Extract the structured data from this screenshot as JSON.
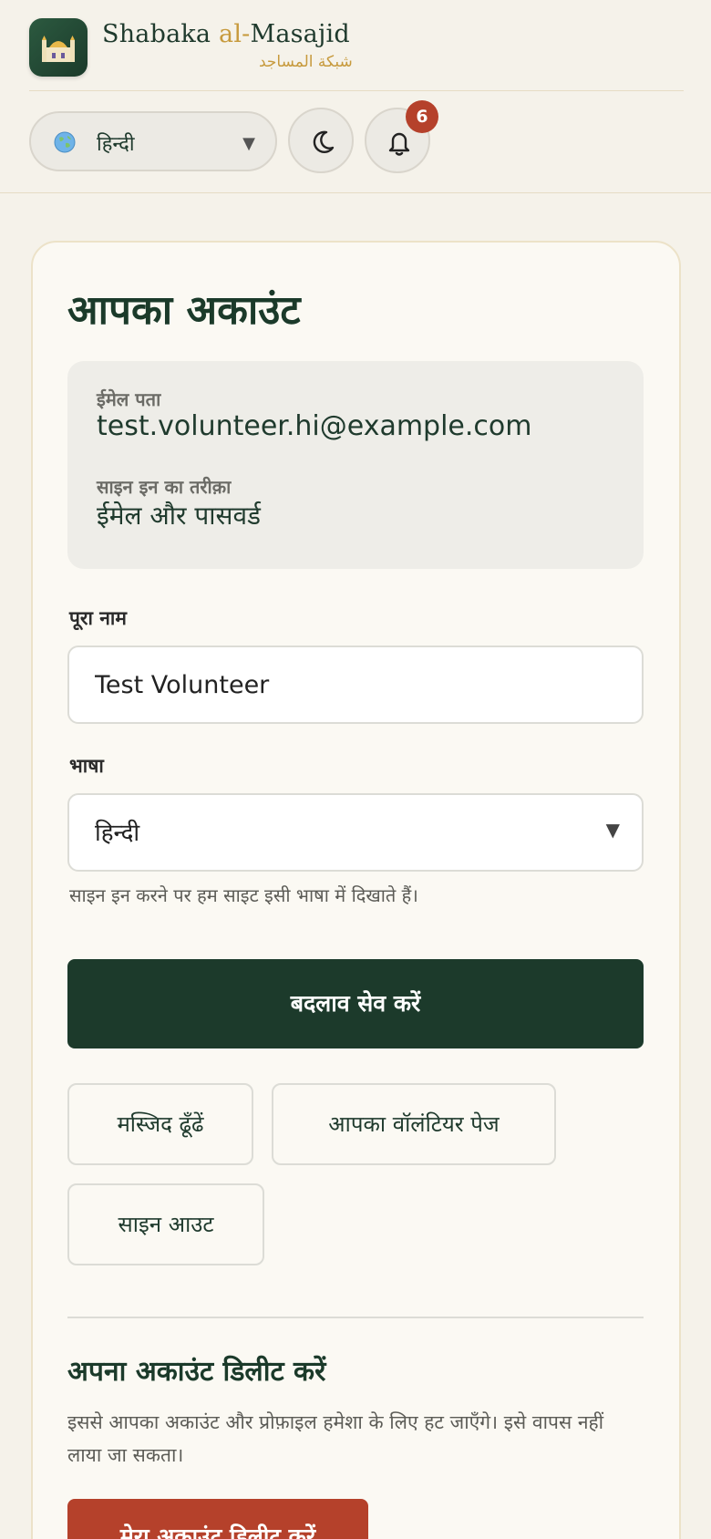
{
  "brand": {
    "name_part1": "Shabaka ",
    "name_part2": "al-",
    "name_part3": "Masajid",
    "arabic": "شبكة المساجد"
  },
  "controls": {
    "language": "हिन्दी",
    "notification_count": "6"
  },
  "account": {
    "title": "आपका अकाउंट",
    "email_label": "ईमेल पता",
    "email_value": "test.volunteer.hi@example.com",
    "signin_method_label": "साइन इन का तरीक़ा",
    "signin_method_value": "ईमेल और पासवर्ड",
    "full_name_label": "पूरा नाम",
    "full_name_value": "Test Volunteer",
    "language_label": "भाषा",
    "language_value": "हिन्दी",
    "language_help": "साइन इन करने पर हम साइट इसी भाषा में दिखाते हैं।",
    "save_button": "बदलाव सेव करें",
    "find_mosque_button": "मस्जिद ढूँढें",
    "volunteer_page_button": "आपका वॉलंटियर पेज",
    "sign_out_button": "साइन आउट"
  },
  "delete": {
    "title": "अपना अकाउंट डिलीट करें",
    "text": "इससे आपका अकाउंट और प्रोफ़ाइल हमेशा के लिए हट जाएँगे। इसे वापस नहीं लाया जा सकता।",
    "button": "मेरा अकाउंट डिलीट करें"
  },
  "colors": {
    "primary": "#1c3a2b",
    "accent_gold": "#c79a3d",
    "danger": "#b5412b",
    "background": "#f5f2ea"
  },
  "icons": {
    "logo": "mosque-icon",
    "language": "globe-icon",
    "theme": "moon-icon",
    "notifications": "bell-icon"
  }
}
